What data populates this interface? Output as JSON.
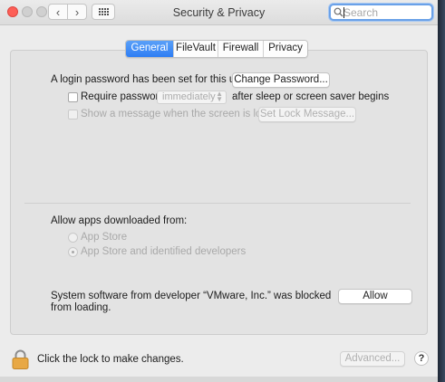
{
  "window": {
    "title": "Security & Privacy",
    "nav_back": "‹",
    "nav_forward": "›"
  },
  "search": {
    "placeholder": "Search",
    "value": ""
  },
  "tabs": [
    {
      "label": "General",
      "active": true
    },
    {
      "label": "FileVault",
      "active": false
    },
    {
      "label": "Firewall",
      "active": false
    },
    {
      "label": "Privacy",
      "active": false
    }
  ],
  "general": {
    "login_password_text": "A login password has been set for this user",
    "change_password_button": "Change Password...",
    "require_password_label": "Require password",
    "require_password_checked": false,
    "require_password_timing": "immediately",
    "after_sleep_text": "after sleep or screen saver begins",
    "show_message_label": "Show a message when the screen is locked",
    "show_message_checked": false,
    "set_lock_message_button": "Set Lock Message...",
    "allow_apps_heading": "Allow apps downloaded from:",
    "radio_app_store": "App Store",
    "radio_app_store_identified": "App Store and identified developers",
    "selected_source": "App Store and identified developers",
    "blocked_text_line1": "System software from developer “VMware, Inc.” was blocked",
    "blocked_text_line2": "from loading.",
    "allow_button": "Allow"
  },
  "footer": {
    "lock_text": "Click the lock to make changes.",
    "advanced_button": "Advanced...",
    "help_button": "?"
  },
  "colors": {
    "accent": "#2e7ef4",
    "close_button": "#fd5f57",
    "lock_icon": "#e8a844"
  }
}
